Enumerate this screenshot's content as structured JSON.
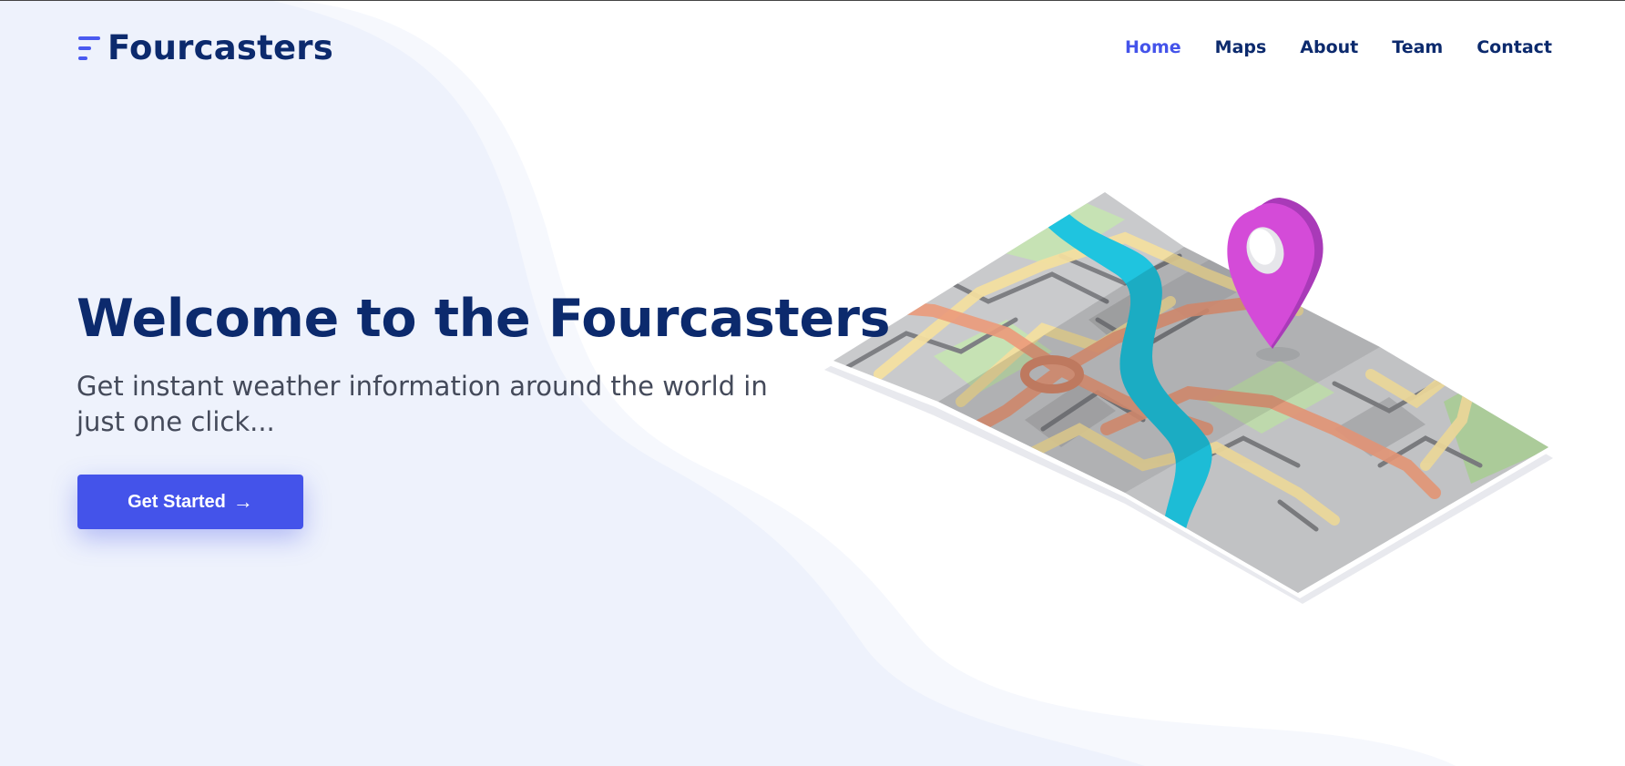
{
  "brand": {
    "name": "Fourcasters",
    "accent_color": "#4453ea",
    "text_color": "#0c2a6d"
  },
  "nav": {
    "items": [
      {
        "label": "Home",
        "active": true
      },
      {
        "label": "Maps",
        "active": false
      },
      {
        "label": "About",
        "active": false
      },
      {
        "label": "Team",
        "active": false
      },
      {
        "label": "Contact",
        "active": false
      }
    ]
  },
  "hero": {
    "title": "Welcome to the Fourcasters",
    "subtitle": "Get instant weather information around the world in just one click...",
    "cta_label": "Get Started",
    "cta_icon": "arrow-right-icon"
  },
  "illustration": {
    "name": "folded-map-with-location-pin",
    "pin_color": "#c43fd0",
    "river_color": "#1fb8d8"
  }
}
